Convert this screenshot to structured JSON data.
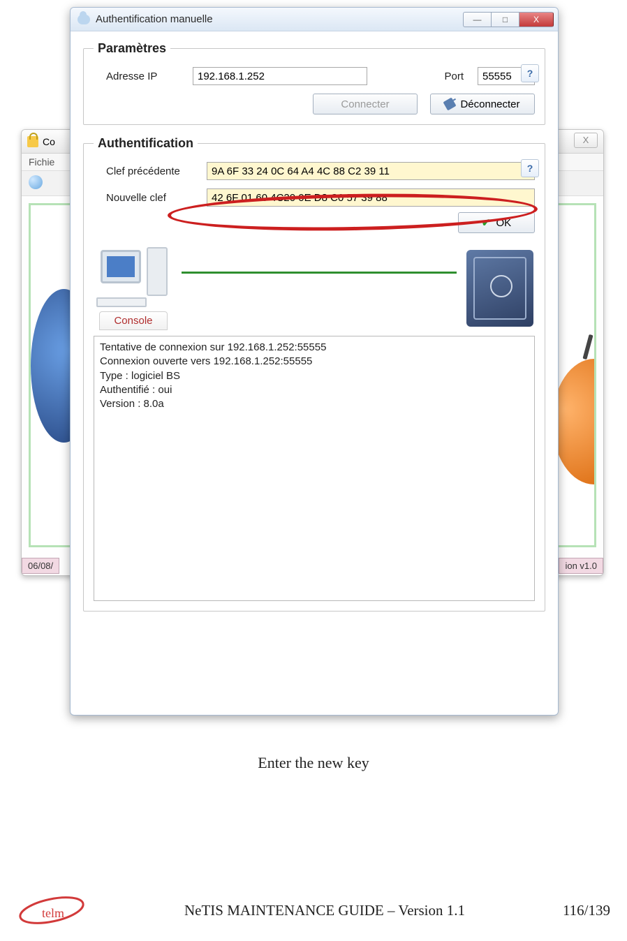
{
  "back_window": {
    "title_fragment": "Co",
    "menu_fragment": "Fichie",
    "status_left": "06/08/",
    "status_right": "ion v1.0"
  },
  "front_window": {
    "title": "Authentification manuelle",
    "groups": {
      "params": {
        "legend": "Paramètres",
        "ip_label": "Adresse IP",
        "ip_value": "192.168.1.252",
        "port_label": "Port",
        "port_value": "55555",
        "connect_label": "Connecter",
        "disconnect_label": "Déconnecter"
      },
      "auth": {
        "legend": "Authentification",
        "prev_key_label": "Clef précédente",
        "prev_key_value": "9A 6F 33 24 0C 64 A4 4C 88 C2 39 11",
        "new_key_label": "Nouvelle clef",
        "new_key_value": "42 6F 01 60 4C20 0E D8 C0 57 39 88",
        "ok_label": "OK"
      }
    },
    "console_tab": "Console",
    "log": "Tentative de connexion sur 192.168.1.252:55555\nConnexion ouverte vers 192.168.1.252:55555\nType : logiciel BS\nAuthentifié : oui\nVersion : 8.0a"
  },
  "caption": "Enter the new key",
  "footer": {
    "logo_text": "telm",
    "center": "NeTIS MAINTENANCE GUIDE – Version 1.1",
    "page": "116/139"
  },
  "help_glyph": "?",
  "close_glyph": "X",
  "min_glyph": "—",
  "max_glyph": "□"
}
